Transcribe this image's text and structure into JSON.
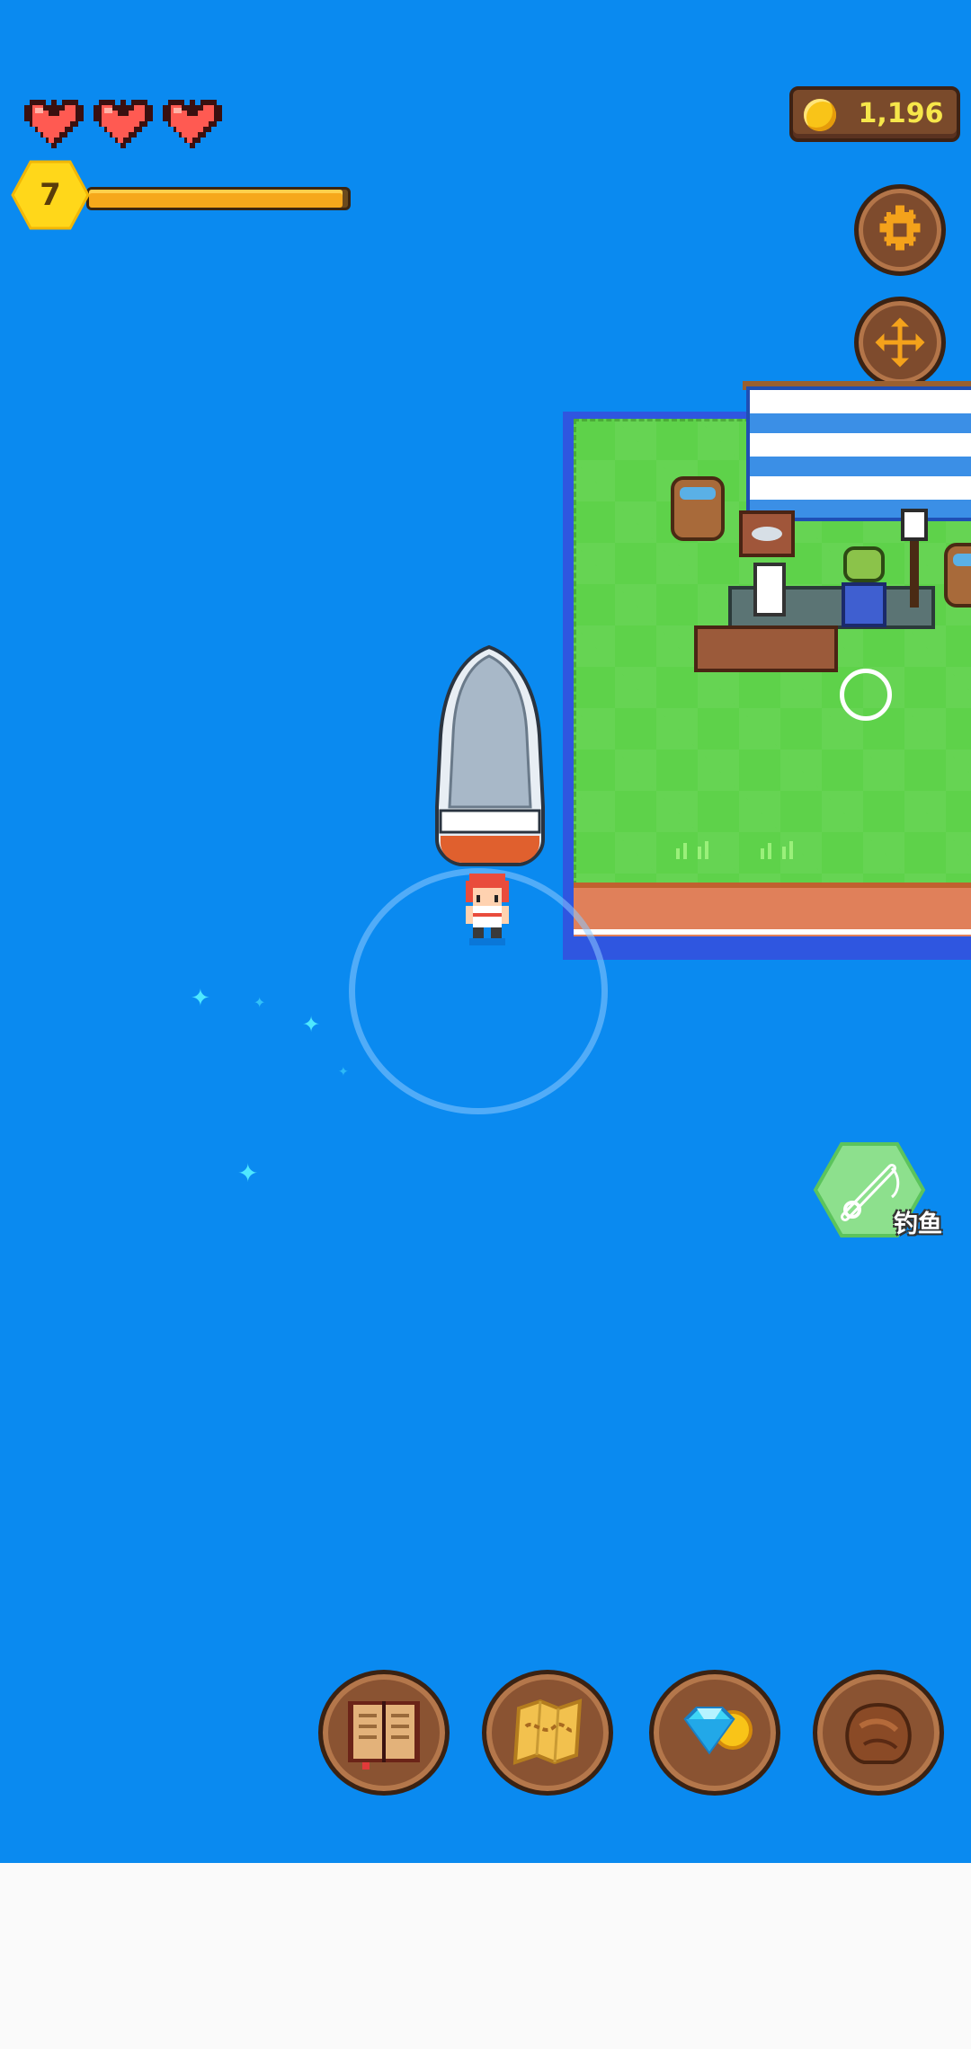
{
  "hud": {
    "hearts": [
      "heart",
      "heart",
      "heart"
    ],
    "level": "7",
    "xp_progress": 0.98,
    "coins": "1,196",
    "settings_icon": "gear-icon",
    "move_icon": "move-arrows-icon"
  },
  "world": {
    "fishing_action_label": "钓鱼",
    "fishing_icon": "fishing-rod-icon"
  },
  "toolbar": {
    "buttons": [
      {
        "icon": "book-icon"
      },
      {
        "icon": "map-icon"
      },
      {
        "icon": "gem-coin-shop-icon"
      },
      {
        "icon": "leather-bag-icon"
      }
    ]
  },
  "colors": {
    "water": "#0a8af0",
    "grass": "#5ed24a",
    "heart": "#ff4f4f",
    "level_badge": "#ffd71a",
    "xp_fill": "#f6a81b",
    "coin_text": "#f6e64a",
    "wood": "#7e4b2d"
  }
}
